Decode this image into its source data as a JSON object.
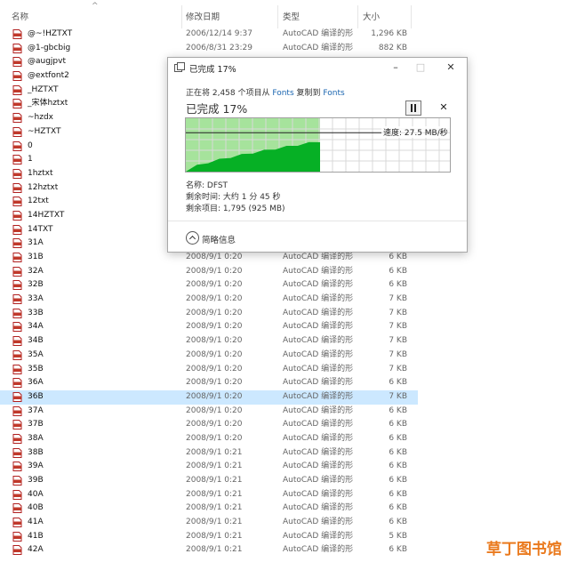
{
  "header": {
    "col_name": "名称",
    "col_date": "修改日期",
    "col_type": "类型",
    "col_size": "大小"
  },
  "files": [
    {
      "name": "@~!HZTXT",
      "date": "2006/12/14 9:37",
      "type": "AutoCAD 编译的形",
      "size": "1,296 KB"
    },
    {
      "name": "@1-gbcbig",
      "date": "2006/8/31 23:29",
      "type": "AutoCAD 编译的形",
      "size": "882 KB"
    },
    {
      "name": "@augjpvt",
      "date": "",
      "type": "",
      "size": ""
    },
    {
      "name": "@extfont2",
      "date": "",
      "type": "",
      "size": ""
    },
    {
      "name": "_HZTXT",
      "date": "",
      "type": "",
      "size": ""
    },
    {
      "name": "_宋体hztxt",
      "date": "",
      "type": "",
      "size": ""
    },
    {
      "name": "~hzdx",
      "date": "",
      "type": "",
      "size": ""
    },
    {
      "name": "~HZTXT",
      "date": "",
      "type": "",
      "size": ""
    },
    {
      "name": "0",
      "date": "",
      "type": "",
      "size": ""
    },
    {
      "name": "1",
      "date": "",
      "type": "",
      "size": ""
    },
    {
      "name": "1hztxt",
      "date": "",
      "type": "",
      "size": ""
    },
    {
      "name": "12hztxt",
      "date": "",
      "type": "",
      "size": ""
    },
    {
      "name": "12txt",
      "date": "",
      "type": "",
      "size": ""
    },
    {
      "name": "14HZTXT",
      "date": "",
      "type": "",
      "size": ""
    },
    {
      "name": "14TXT",
      "date": "",
      "type": "",
      "size": ""
    },
    {
      "name": "31A",
      "date": "",
      "type": "",
      "size": ""
    },
    {
      "name": "31B",
      "date": "2008/9/1 0:20",
      "type": "AutoCAD 编译的形",
      "size": "6 KB"
    },
    {
      "name": "32A",
      "date": "2008/9/1 0:20",
      "type": "AutoCAD 编译的形",
      "size": "6 KB"
    },
    {
      "name": "32B",
      "date": "2008/9/1 0:20",
      "type": "AutoCAD 编译的形",
      "size": "6 KB"
    },
    {
      "name": "33A",
      "date": "2008/9/1 0:20",
      "type": "AutoCAD 编译的形",
      "size": "7 KB"
    },
    {
      "name": "33B",
      "date": "2008/9/1 0:20",
      "type": "AutoCAD 编译的形",
      "size": "7 KB"
    },
    {
      "name": "34A",
      "date": "2008/9/1 0:20",
      "type": "AutoCAD 编译的形",
      "size": "7 KB"
    },
    {
      "name": "34B",
      "date": "2008/9/1 0:20",
      "type": "AutoCAD 编译的形",
      "size": "7 KB"
    },
    {
      "name": "35A",
      "date": "2008/9/1 0:20",
      "type": "AutoCAD 编译的形",
      "size": "7 KB"
    },
    {
      "name": "35B",
      "date": "2008/9/1 0:20",
      "type": "AutoCAD 编译的形",
      "size": "7 KB"
    },
    {
      "name": "36A",
      "date": "2008/9/1 0:20",
      "type": "AutoCAD 编译的形",
      "size": "6 KB"
    },
    {
      "name": "36B",
      "date": "2008/9/1 0:20",
      "type": "AutoCAD 编译的形",
      "size": "7 KB",
      "selected": true
    },
    {
      "name": "37A",
      "date": "2008/9/1 0:20",
      "type": "AutoCAD 编译的形",
      "size": "6 KB"
    },
    {
      "name": "37B",
      "date": "2008/9/1 0:20",
      "type": "AutoCAD 编译的形",
      "size": "6 KB"
    },
    {
      "name": "38A",
      "date": "2008/9/1 0:20",
      "type": "AutoCAD 编译的形",
      "size": "6 KB"
    },
    {
      "name": "38B",
      "date": "2008/9/1 0:21",
      "type": "AutoCAD 编译的形",
      "size": "6 KB"
    },
    {
      "name": "39A",
      "date": "2008/9/1 0:21",
      "type": "AutoCAD 编译的形",
      "size": "6 KB"
    },
    {
      "name": "39B",
      "date": "2008/9/1 0:21",
      "type": "AutoCAD 编译的形",
      "size": "6 KB"
    },
    {
      "name": "40A",
      "date": "2008/9/1 0:21",
      "type": "AutoCAD 编译的形",
      "size": "6 KB"
    },
    {
      "name": "40B",
      "date": "2008/9/1 0:21",
      "type": "AutoCAD 编译的形",
      "size": "6 KB"
    },
    {
      "name": "41A",
      "date": "2008/9/1 0:21",
      "type": "AutoCAD 编译的形",
      "size": "6 KB"
    },
    {
      "name": "41B",
      "date": "2008/9/1 0:21",
      "type": "AutoCAD 编译的形",
      "size": "5 KB"
    },
    {
      "name": "42A",
      "date": "2008/9/1 0:21",
      "type": "AutoCAD 编译的形",
      "size": "6 KB"
    }
  ],
  "dialog": {
    "title": "已完成 17%",
    "copy_prefix": "正在将 2,458 个项目从 ",
    "copy_from": "Fonts",
    "copy_mid": " 复制到 ",
    "copy_to": "Fonts",
    "percent_text": "已完成 17%",
    "progress": 0.17,
    "speed": "速度: 27.5 MB/秒",
    "name_line": "名称: DFST",
    "time_line": "剩余时间: 大约 1 分 45 秒",
    "items_line": "剩余项目: 1,795 (925 MB)",
    "details_label": "简略信息",
    "pause_icon": "pause-icon",
    "stop_icon": "close-icon"
  },
  "watermark": "草丁图书馆",
  "colors": {
    "accent": "#06b025",
    "done_fill": "#a6e39c",
    "selection": "#cce8ff",
    "link": "#1a65b0"
  }
}
